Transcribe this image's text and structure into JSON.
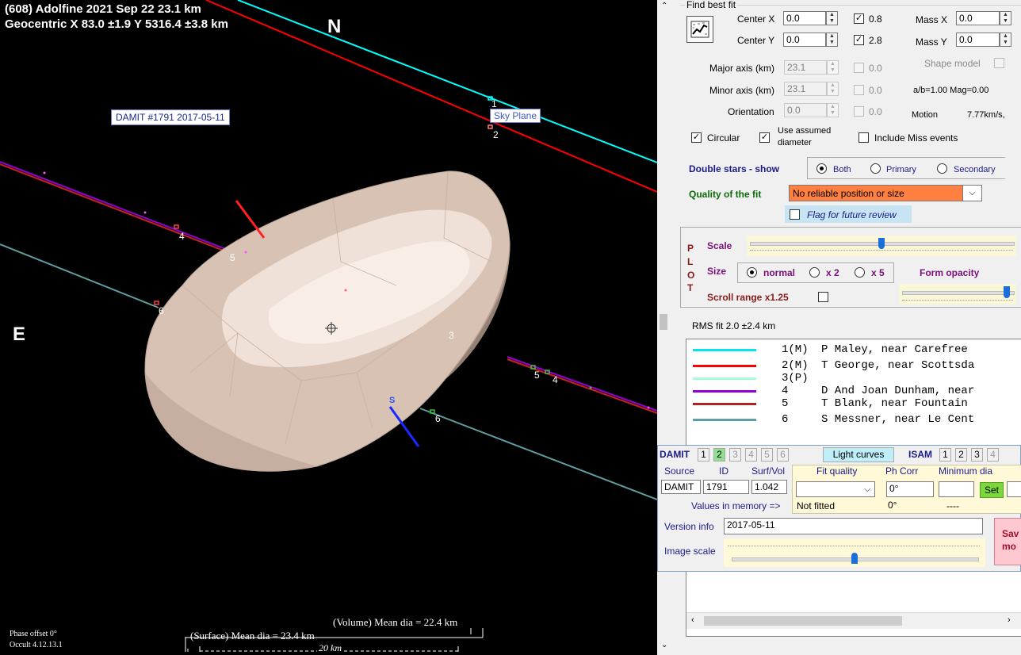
{
  "plot": {
    "title_line1": "(608) Adolfine  2021 Sep 22   23.1 km",
    "title_line2": "Geocentric  X  83.0 ±1.9  Y 5316.4 ±3.8 km",
    "north_label": "N",
    "east_label": "E",
    "south_label": "S",
    "damit_label": "DAMIT #1791 2017-05-11",
    "sky_plane_label": "Sky Plane",
    "chord_labels": [
      "1",
      "2",
      "3",
      "4",
      "5",
      "6",
      "4",
      "5",
      "6"
    ],
    "volume_mean": "(Volume) Mean dia = 22.4 km",
    "surface_mean": "(Surface) Mean dia = 23.4 km",
    "scale_bar": "20 km",
    "phase_offset": "Phase offset 0°",
    "version": "Occult 4.12.13.1",
    "colors": {
      "chord1": "#00ffff",
      "chord2": "#ff0000",
      "chord3": "#7fffd4",
      "chord4": "#9400d3",
      "chord5": "#a52a2a",
      "chord6": "#5f9ea0"
    }
  },
  "fit": {
    "heading": "Find best fit",
    "center_x_label": "Center X",
    "center_x": "0.0",
    "center_y_label": "Center Y",
    "center_y": "0.0",
    "cb_08": "0.8",
    "cb_28": "2.8",
    "mass_x_label": "Mass X",
    "mass_x": "0.0",
    "mass_y_label": "Mass Y",
    "mass_y": "0.0",
    "major_label": "Major axis (km)",
    "major": "23.1",
    "major_cb": "0.0",
    "minor_label": "Minor axis (km)",
    "minor": "23.1",
    "minor_cb": "0.0",
    "orient_label": "Orientation",
    "orient": "0.0",
    "orient_cb": "0.0",
    "shape_model_label": "Shape model",
    "ab_mag": "a/b=1.00 Mag=0.00",
    "motion_label": "Motion",
    "motion": "7.77km/s, ",
    "circular_label": "Circular",
    "use_assumed_label1": "Use assumed",
    "use_assumed_label2": "diameter",
    "include_miss_label": "Include Miss events"
  },
  "double": {
    "label": "Double stars - show",
    "both": "Both",
    "primary": "Primary",
    "secondary": "Secondary"
  },
  "quality": {
    "label": "Quality of the fit",
    "value": "No reliable position or size",
    "flag_label": "Flag for future review"
  },
  "plotbox": {
    "letters": [
      "P",
      "L",
      "O",
      "T"
    ],
    "scale_label": "Scale",
    "size_label": "Size",
    "normal": "normal",
    "x2": "x 2",
    "x5": "x 5",
    "form_opacity": "Form opacity",
    "scroll_range": "Scroll range x1.25",
    "scale_value": 0.5,
    "opacity_value": 0.97
  },
  "rms": "RMS fit 2.0 ±2.4 km",
  "observers": [
    {
      "num": "1(M)",
      "name": "P Maley, near Carefree",
      "color": "#00e5ee"
    },
    {
      "num": "2(M)",
      "name": "T George, near Scottsda",
      "color": "#ff0000"
    },
    {
      "num": "3(P)",
      "name": "",
      "color": "#a0ffd6"
    },
    {
      "num": "4",
      "name": "D And Joan Dunham, near",
      "color": "#9400d3"
    },
    {
      "num": "5",
      "name": "T Blank, near Fountain",
      "color": "#b22222"
    },
    {
      "num": "6",
      "name": "S Messner, near Le Cent",
      "color": "#5f9ea0"
    }
  ],
  "damit": {
    "title": "DAMIT",
    "tabs": [
      "1",
      "2",
      "3",
      "4",
      "5",
      "6"
    ],
    "light_curves": "Light curves",
    "isam": "ISAM",
    "isam_tabs": [
      "1",
      "2",
      "3",
      "4"
    ],
    "source_label": "Source",
    "id_label": "ID",
    "surfvol_label": "Surf/Vol",
    "source": "DAMIT",
    "id": "1791",
    "surfvol": "1.042",
    "fit_quality_label": "Fit quality",
    "ph_corr_label": "Ph Corr",
    "min_dia_label": "Minimum dia",
    "ph_corr": "0°",
    "set_label": "Set",
    "values_in_memory": "Values in memory =>",
    "not_fitted": "Not fitted",
    "ph_mem": "0°",
    "dash_mem": "----",
    "version_info_label": "Version info",
    "version_info": "2017-05-11",
    "image_scale_label": "Image scale",
    "save_label1": "Sav",
    "save_label2": "mo",
    "image_scale_value": 0.5
  }
}
